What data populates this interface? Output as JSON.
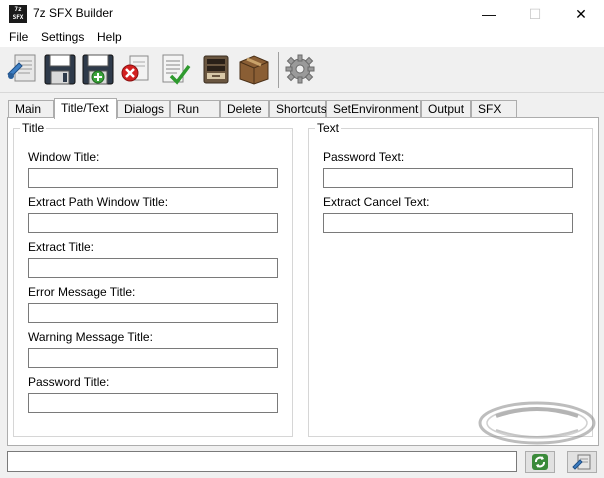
{
  "window": {
    "title": "7z SFX Builder",
    "icon_text_top": "7z",
    "icon_text_bottom": "SFX",
    "minimize_glyph": "—",
    "maximize_glyph": "☐",
    "close_glyph": "✕"
  },
  "menu": [
    {
      "label": "File"
    },
    {
      "label": "Settings"
    },
    {
      "label": "Help"
    }
  ],
  "toolbar": [
    {
      "icon": "open-config-icon"
    },
    {
      "icon": "save-icon"
    },
    {
      "icon": "save-as-icon"
    },
    {
      "icon": "clear-icon"
    },
    {
      "icon": "notes-icon"
    },
    {
      "icon": "check-icon"
    },
    {
      "icon": "archive-box-icon"
    },
    {
      "icon": "package-box-icon"
    },
    {
      "icon": "gear-icon"
    }
  ],
  "tabs": [
    {
      "label": "Main"
    },
    {
      "label": "Title/Text"
    },
    {
      "label": "Dialogs"
    },
    {
      "label": "Run"
    },
    {
      "label": "Delete"
    },
    {
      "label": "Shortcuts"
    },
    {
      "label": "SetEnvironment"
    },
    {
      "label": "Output"
    },
    {
      "label": "SFX"
    }
  ],
  "active_tab": "Title/Text",
  "title_group": {
    "legend": "Title",
    "fields": [
      {
        "label": "Window Title:",
        "value": ""
      },
      {
        "label": "Extract Path Window Title:",
        "value": ""
      },
      {
        "label": "Extract Title:",
        "value": ""
      },
      {
        "label": "Error Message Title:",
        "value": ""
      },
      {
        "label": "Warning Message Title:",
        "value": ""
      },
      {
        "label": "Password Title:",
        "value": ""
      }
    ]
  },
  "text_group": {
    "legend": "Text",
    "fields": [
      {
        "label": "Password Text:",
        "value": ""
      },
      {
        "label": "Extract Cancel Text:",
        "value": ""
      }
    ]
  },
  "status": {
    "value": "",
    "refresh_icon": "refresh-icon",
    "page_icon": "page-icon"
  },
  "colors": {
    "background": "#f0f0f0",
    "panel": "#ffffff",
    "border": "#adadad",
    "input_border": "#7a7a7a"
  }
}
